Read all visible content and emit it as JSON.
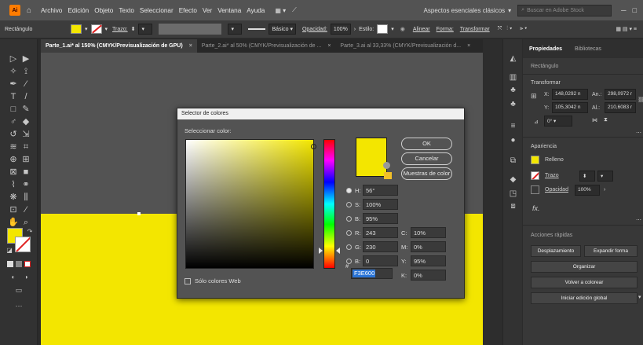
{
  "menubar": {
    "logo": "Ai",
    "items": [
      "Archivo",
      "Edición",
      "Objeto",
      "Texto",
      "Seleccionar",
      "Efecto",
      "Ver",
      "Ventana",
      "Ayuda"
    ],
    "workspace": "Aspectos esenciales clásicos",
    "search_placeholder": "Buscar en Adobe Stock"
  },
  "controlbar": {
    "shape_label": "Rectángulo",
    "stroke_label": "Trazo:",
    "brush_label": "Básico",
    "opacity_label": "Opacidad:",
    "opacity_value": "100%",
    "style_label": "Estilo:",
    "align_label": "Alinear",
    "shape_link": "Forma:",
    "transform_link": "Transformar"
  },
  "tabs": [
    {
      "label": "Parte_1.ai* al 150% (CMYK/Previsualización de GPU)",
      "active": true
    },
    {
      "label": "Parte_2.ai* al 50% (CMYK/Previsualización de ...",
      "active": false
    },
    {
      "label": "Parte_3.ai al 33,33% (CMYK/Previsualización d...",
      "active": false
    }
  ],
  "properties": {
    "tab_properties": "Propiedades",
    "tab_libraries": "Bibliotecas",
    "object_type": "Rectángulo",
    "transform_title": "Transformar",
    "x_label": "X:",
    "x_value": "148,0292 n",
    "y_label": "Y:",
    "y_value": "105,3042 n",
    "w_label": "An.:",
    "w_value": "298,0972 r",
    "h_label": "Al.:",
    "h_value": "210,6083 r",
    "angle_value": "0°",
    "appearance_title": "Apariencia",
    "fill_label": "Relleno",
    "stroke_label": "Trazo",
    "opacity_label": "Opacidad",
    "opacity_value": "100%",
    "fx_label": "fx.",
    "quick_actions_title": "Acciones rápidas",
    "btn_offset": "Desplazamiento",
    "btn_expand": "Expandir forma",
    "btn_arrange": "Organizar",
    "btn_recolor": "Volver a colorear",
    "btn_global_edit": "Iniciar edición global"
  },
  "dialog": {
    "title": "Selector de colores",
    "subtitle": "Seleccionar color:",
    "ok": "OK",
    "cancel": "Cancelar",
    "swatches": "Muestras de color",
    "h_label": "H:",
    "h_value": "56°",
    "s_label": "S:",
    "s_value": "100%",
    "b_label": "B:",
    "b_value": "95%",
    "r_label": "R:",
    "r_value": "243",
    "g_label": "G:",
    "g_value": "230",
    "bb_label": "B:",
    "bb_value": "0",
    "c_label": "C:",
    "c_value": "10%",
    "m_label": "M:",
    "m_value": "0%",
    "y_label": "Y:",
    "y_value": "95%",
    "k_label": "K:",
    "k_value": "0%",
    "hex_label": "#",
    "hex_value": "F3E600",
    "web_only": "Sólo colores Web"
  },
  "colors": {
    "current": "#f3e600",
    "accent": "#2a74d6"
  }
}
